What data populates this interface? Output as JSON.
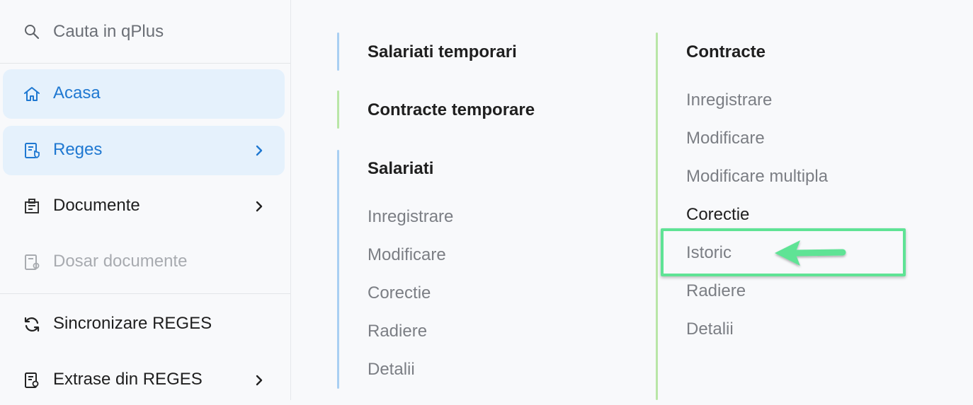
{
  "search": {
    "placeholder": "Cauta in qPlus",
    "icon": "search-icon"
  },
  "sidebar": {
    "items": [
      {
        "label": "Acasa",
        "icon": "home-icon",
        "state": "active",
        "has_submenu": false
      },
      {
        "label": "Reges",
        "icon": "reges-document-icon",
        "state": "active",
        "has_submenu": true
      },
      {
        "label": "Documente",
        "icon": "documents-icon",
        "state": "normal",
        "has_submenu": true
      },
      {
        "label": "Dosar documente",
        "icon": "dossier-icon",
        "state": "disabled",
        "has_submenu": false
      },
      {
        "label": "Sincronizare REGES",
        "icon": "sync-icon",
        "state": "normal",
        "has_submenu": false
      },
      {
        "label": "Extrase din REGES",
        "icon": "extract-icon",
        "state": "normal",
        "has_submenu": true
      }
    ]
  },
  "columns": {
    "left": {
      "sections": [
        {
          "title": "Salariati temporari",
          "accent": "#a9cff2",
          "links": []
        },
        {
          "title": "Contracte temporare",
          "accent": "#b9e6a7",
          "links": []
        },
        {
          "title": "Salariati",
          "accent": "#a9cff2",
          "links": [
            "Inregistrare",
            "Modificare",
            "Corectie",
            "Radiere",
            "Detalii"
          ]
        }
      ]
    },
    "right": {
      "title": "Contracte",
      "accent": "#b9e6a7",
      "links": [
        "Inregistrare",
        "Modificare",
        "Modificare multipla",
        "Corectie",
        "Istoric",
        "Radiere",
        "Detalii"
      ],
      "highlighted": "Istoric"
    }
  },
  "colors": {
    "active_bg": "#e5f1fc",
    "active_text": "#1f78d1",
    "highlight_annotation": "#5fe395"
  }
}
